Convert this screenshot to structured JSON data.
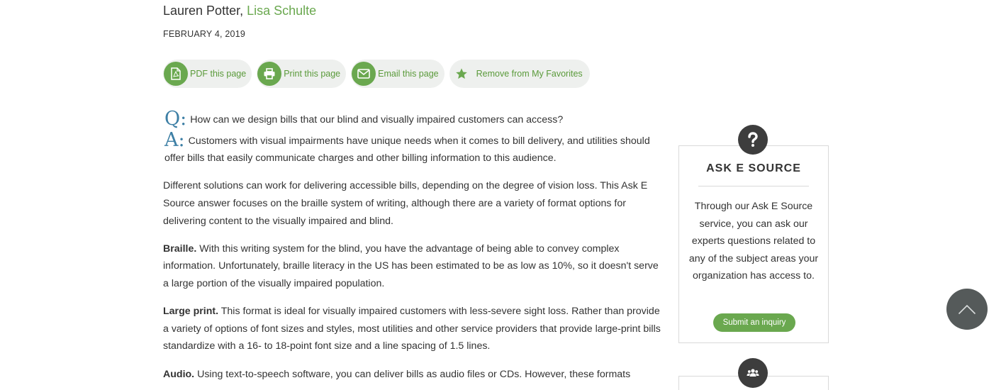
{
  "byline": {
    "author_plain": "Lauren Potter,",
    "author_link": "Lisa Schulte",
    "date": "FEBRUARY 4, 2019"
  },
  "actions": {
    "pdf": "PDF this page",
    "print": "Print this page",
    "email": "Email this page",
    "favorite": "Remove from My Favorites"
  },
  "article": {
    "q_mark": "Q:",
    "question": "How can we design bills that our blind and visually impaired customers can access?",
    "a_mark": "A:",
    "answer": "Customers with visual impairments have unique needs when it comes to bill delivery, and utilities should offer bills that easily communicate charges and other billing information to this audience.",
    "para1": "Different solutions can work for delivering accessible bills, depending on the degree of vision loss. This Ask E Source answer focuses on the braille system of writing, although there are a variety of format options for delivering content to the visually impaired and blind.",
    "braille_label": "Braille.",
    "braille_text": " With this writing system for the blind, you have the advantage of being able to convey complex information. Unfortunately, braille literacy in the US has been estimated to be as low as 10%, so it doesn't serve a large portion of the visually impaired population.",
    "large_label": "Large print.",
    "large_text": " This format is ideal for visually impaired customers with less-severe sight loss. Rather than provide a variety of options of font sizes and styles, most utilities and other service providers that provide large-print bills standardize with a 16- to 18-point font size and a line spacing of 1.5 lines.",
    "audio_label": "Audio.",
    "audio_text": " Using text-to-speech software, you can deliver bills as audio files or CDs. However, these formats"
  },
  "sidebar": {
    "title": "ASK E SOURCE",
    "body": "Through our Ask E Source service, you can ask our experts questions related to any of the subject areas your organization has access to.",
    "submit_label": "Submit an inquiry"
  },
  "icons": {
    "pdf": "pdf-file-icon",
    "print": "printer-icon",
    "email": "envelope-icon",
    "favorite": "star-icon",
    "ask": "question-mark-icon",
    "group": "users-icon",
    "scroll": "chevron-up-icon"
  },
  "colors": {
    "accent_green": "#6aa84f",
    "qa_blue": "#3d7fa5",
    "dark_icon": "#3d3d3d"
  }
}
